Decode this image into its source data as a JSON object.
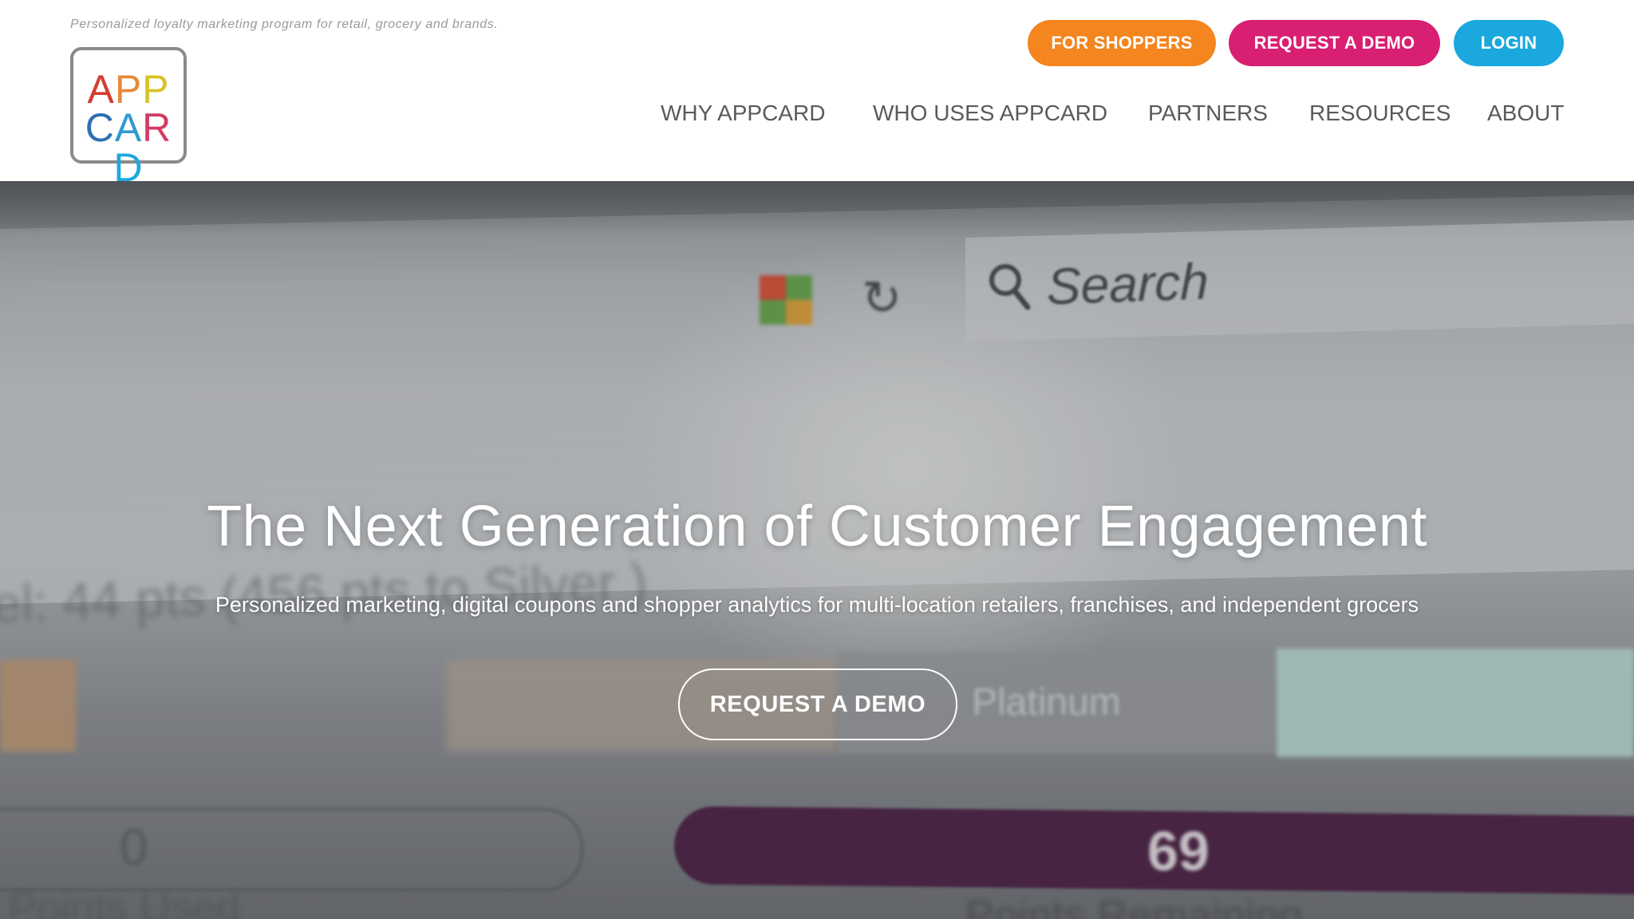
{
  "header": {
    "tagline": "Personalized loyalty marketing program for retail, grocery and brands.",
    "logo": {
      "line1": [
        "A",
        "P",
        "P"
      ],
      "line2": [
        "C",
        "A",
        "R",
        "D"
      ],
      "line1_colors": [
        "#d63a2f",
        "#e6893a",
        "#d8c327"
      ],
      "line2_colors": [
        "#2f6fb0",
        "#2e9ad3",
        "#d23b62",
        "#1ba8de"
      ]
    },
    "buttons": {
      "shoppers": "FOR SHOPPERS",
      "demo": "REQUEST A DEMO",
      "login": "LOGIN"
    },
    "nav": [
      "WHY APPCARD",
      "WHO USES APPCARD",
      "PARTNERS",
      "RESOURCES",
      "ABOUT"
    ]
  },
  "hero": {
    "background": {
      "search_label": "Search",
      "ghost_text": "el: 44 pts (456 pts to Silver )",
      "tier_label": "Platinum",
      "points_used_value": "0",
      "points_remaining_value": "69",
      "points_used_label": "Points Used",
      "points_remaining_label": "Points Remaining"
    },
    "title": "The Next Generation of Customer Engagement",
    "subtitle": "Personalized marketing, digital coupons and shopper analytics for multi-location retailers, franchises, and independent grocers",
    "cta": "REQUEST A DEMO"
  },
  "colors": {
    "orange": "#f4851f",
    "magenta": "#d91f72",
    "blue": "#1ba8de",
    "nav_text": "#5a5a5a"
  }
}
